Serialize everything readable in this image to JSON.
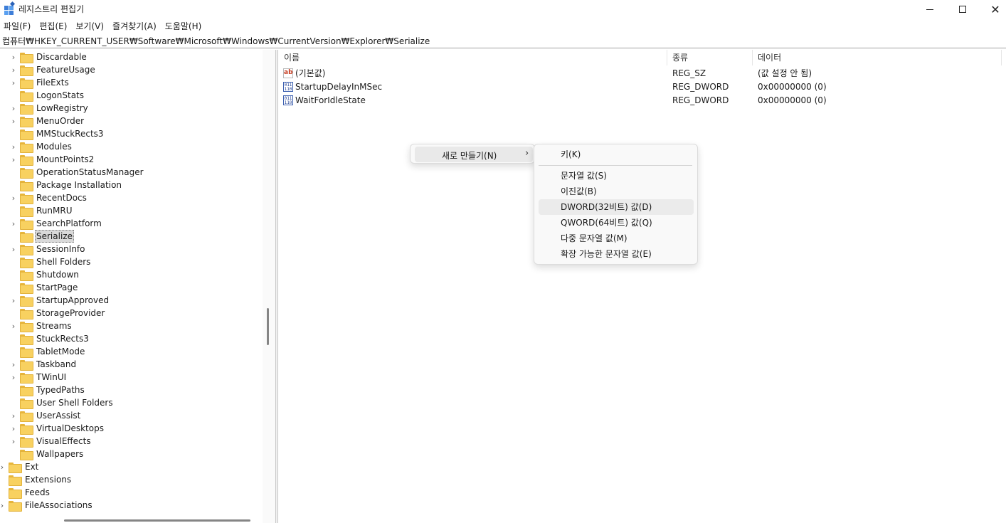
{
  "window": {
    "title": "레지스트리 편집기",
    "minimize": "",
    "maximize": "",
    "close": "✕"
  },
  "menu": [
    "파일(F)",
    "편집(E)",
    "보기(V)",
    "즐겨찾기(A)",
    "도움말(H)"
  ],
  "address": "컴퓨터₩HKEY_CURRENT_USER₩Software₩Microsoft₩Windows₩CurrentVersion₩Explorer₩Serialize",
  "tree": {
    "selected": "Serialize",
    "items": [
      {
        "label": "Discardable",
        "expandable": true,
        "level": 1
      },
      {
        "label": "FeatureUsage",
        "expandable": true,
        "level": 1
      },
      {
        "label": "FileExts",
        "expandable": true,
        "level": 1
      },
      {
        "label": "LogonStats",
        "expandable": false,
        "level": 1
      },
      {
        "label": "LowRegistry",
        "expandable": true,
        "level": 1
      },
      {
        "label": "MenuOrder",
        "expandable": true,
        "level": 1
      },
      {
        "label": "MMStuckRects3",
        "expandable": false,
        "level": 1
      },
      {
        "label": "Modules",
        "expandable": true,
        "level": 1
      },
      {
        "label": "MountPoints2",
        "expandable": true,
        "level": 1
      },
      {
        "label": "OperationStatusManager",
        "expandable": false,
        "level": 1
      },
      {
        "label": "Package Installation",
        "expandable": false,
        "level": 1
      },
      {
        "label": "RecentDocs",
        "expandable": true,
        "level": 1
      },
      {
        "label": "RunMRU",
        "expandable": false,
        "level": 1
      },
      {
        "label": "SearchPlatform",
        "expandable": true,
        "level": 1
      },
      {
        "label": "Serialize",
        "expandable": false,
        "level": 1
      },
      {
        "label": "SessionInfo",
        "expandable": true,
        "level": 1
      },
      {
        "label": "Shell Folders",
        "expandable": false,
        "level": 1
      },
      {
        "label": "Shutdown",
        "expandable": false,
        "level": 1
      },
      {
        "label": "StartPage",
        "expandable": false,
        "level": 1
      },
      {
        "label": "StartupApproved",
        "expandable": true,
        "level": 1
      },
      {
        "label": "StorageProvider",
        "expandable": false,
        "level": 1
      },
      {
        "label": "Streams",
        "expandable": true,
        "level": 1
      },
      {
        "label": "StuckRects3",
        "expandable": false,
        "level": 1
      },
      {
        "label": "TabletMode",
        "expandable": false,
        "level": 1
      },
      {
        "label": "Taskband",
        "expandable": true,
        "level": 1
      },
      {
        "label": "TWinUI",
        "expandable": true,
        "level": 1
      },
      {
        "label": "TypedPaths",
        "expandable": false,
        "level": 1
      },
      {
        "label": "User Shell Folders",
        "expandable": false,
        "level": 1
      },
      {
        "label": "UserAssist",
        "expandable": true,
        "level": 1
      },
      {
        "label": "VirtualDesktops",
        "expandable": true,
        "level": 1
      },
      {
        "label": "VisualEffects",
        "expandable": true,
        "level": 1
      },
      {
        "label": "Wallpapers",
        "expandable": false,
        "level": 1
      },
      {
        "label": "Ext",
        "expandable": true,
        "level": 0
      },
      {
        "label": "Extensions",
        "expandable": false,
        "level": 0
      },
      {
        "label": "Feeds",
        "expandable": false,
        "level": 0
      },
      {
        "label": "FileAssociations",
        "expandable": true,
        "level": 0
      }
    ]
  },
  "values": {
    "headers": {
      "name": "이름",
      "type": "종류",
      "data": "데이터"
    },
    "rows": [
      {
        "icon": "string-value-icon",
        "glyph": "ab",
        "name": "(기본값)",
        "type": "REG_SZ",
        "data": "(값 설정 안 됨)"
      },
      {
        "icon": "binary-value-icon",
        "glyph": "011\n110",
        "name": "StartupDelayInMSec",
        "type": "REG_DWORD",
        "data": "0x00000000 (0)"
      },
      {
        "icon": "binary-value-icon",
        "glyph": "011\n110",
        "name": "WaitForIdleState",
        "type": "REG_DWORD",
        "data": "0x00000000 (0)"
      }
    ]
  },
  "context_menu": {
    "parent_label": "새로 만들기(N)",
    "arrow": "›",
    "submenu": [
      {
        "label": "키(K)"
      },
      {
        "label": "문자열 값(S)"
      },
      {
        "label": "이진값(B)"
      },
      {
        "label": "DWORD(32비트) 값(D)",
        "highlighted": true
      },
      {
        "label": "QWORD(64비트) 값(Q)"
      },
      {
        "label": "다중 문자열 값(M)"
      },
      {
        "label": "확장 가능한 문자열 값(E)"
      }
    ]
  }
}
